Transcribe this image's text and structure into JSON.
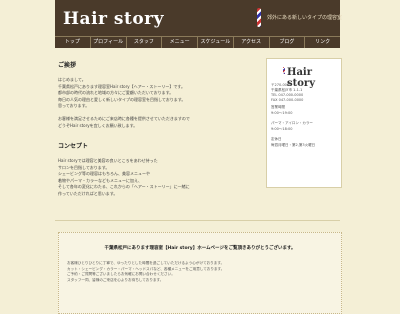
{
  "header": {
    "logo": "Hair story",
    "tagline": "郊外にある新しいタイプの理容室"
  },
  "nav": {
    "items": [
      "トップ",
      "プロフィール",
      "スタッフ",
      "メニュー",
      "スケジュール",
      "アクセス",
      "ブログ",
      "リンク"
    ]
  },
  "main": {
    "greeting_title": "ご挨拶",
    "greeting_body": "はじめまして。\n千葉県松戸にあります理容室Hair story【ヘアー・ストーリー】です。\n都市部の時代の流れと地域の方々にご愛顧いただいております。\n毎日の人気の理由と愛しく新しいタイプの理容室を目指しております。\n思っております。\n\nお客様を満足させるためにご来店時に各種を提供させていただきますので\nどうぞHair storyを宜しくお願い致します。",
    "concept_title": "コンセプト",
    "concept_body": "Hair storyでは理容と美容の良いところをあわせ持った\nサロンを目指しております。\nシェービング等の理容はもちろん、美容メニューや\n着物やパーマ・カラーなどもメニューに加え、\nそして各年の変化にわたる、これからの「ヘアー・ストーリー」に一緒に\n作っていただければと思います。"
  },
  "sidebar": {
    "title": "Hair story",
    "address": "〒270-0000\n千葉県松戸市 1-1-1\nTEL 047-000-0000\nFAX 047-000-0000",
    "hours_label": "営業時間",
    "hours": "9:00〜19:00",
    "menu_label": "パーマ・アイロン・カラー",
    "menu_time": "9:00〜18:00",
    "holiday_label": "定休日",
    "holiday": "毎週月曜日・第2,第3火曜日"
  },
  "notice": {
    "title": "千葉県松戸にあります理容室【Hair story】ホームページをご覧頂きありがとうございます。",
    "body": "お客様ひとりひとりに丁寧で、ゆったりとした時間を過ごしていただけるよう心がけております。\nカット・シェービング・カラー・パーマ・ヘッドスパなど、各種メニューをご用意しております。\nご予約・ご質問等ございましたらお気軽にお問い合わせください。\nスタッフ一同、皆様のご来店を心よりお待ちしております。"
  }
}
